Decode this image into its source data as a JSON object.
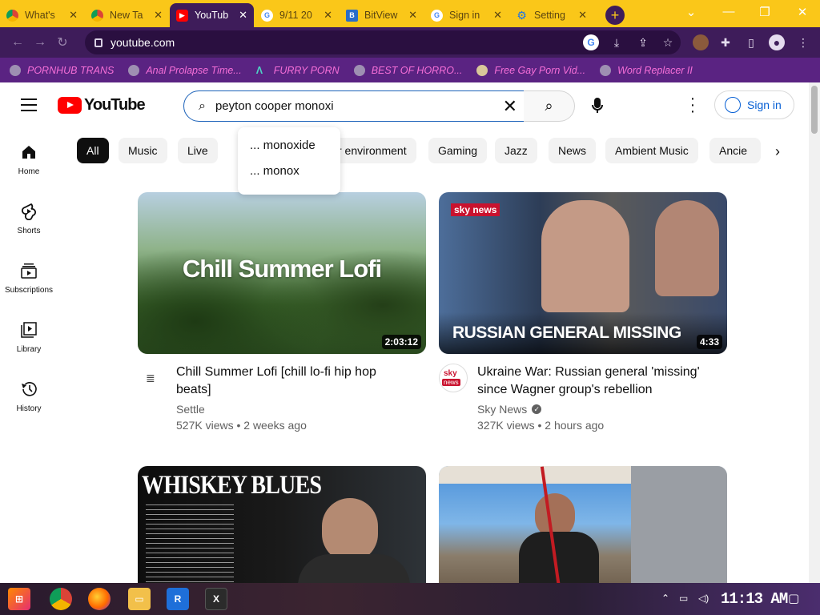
{
  "browser": {
    "tabs": [
      {
        "label": "What's",
        "icon": "chrome-icon",
        "active": false
      },
      {
        "label": "New Ta",
        "icon": "chrome-icon",
        "active": false
      },
      {
        "label": "YouTub",
        "icon": "youtube-icon",
        "active": true
      },
      {
        "label": "9/11 20",
        "icon": "google-icon",
        "active": false
      },
      {
        "label": "BitView",
        "icon": "bitview-icon",
        "active": false
      },
      {
        "label": "Sign in",
        "icon": "google-icon",
        "active": false
      },
      {
        "label": "Setting",
        "icon": "gear-icon",
        "active": false
      }
    ],
    "new_tab_label": "+",
    "url": "youtube.com",
    "bookmarks": [
      {
        "label": "PORNHUB TRANS"
      },
      {
        "label": "Anal Prolapse Time..."
      },
      {
        "label": "FURRY PORN"
      },
      {
        "label": "BEST OF HORRO..."
      },
      {
        "label": "Free Gay Porn Vid..."
      },
      {
        "label": "Word Replacer II"
      }
    ]
  },
  "youtube": {
    "logo_text": "YouTube",
    "search": {
      "query": "peyton cooper monoxi",
      "suggestions": [
        "... monoxide",
        "... monox"
      ]
    },
    "sign_in_label": "Sign in",
    "guide": [
      {
        "label": "Home",
        "icon": "home-icon"
      },
      {
        "label": "Shorts",
        "icon": "shorts-icon"
      },
      {
        "label": "Subscriptions",
        "icon": "subscriptions-icon"
      },
      {
        "label": "Library",
        "icon": "library-icon"
      },
      {
        "label": "History",
        "icon": "history-icon"
      }
    ],
    "chips": [
      "All",
      "Music",
      "Live",
      "r environment",
      "Gaming",
      "Jazz",
      "News",
      "Ambient Music",
      "Ancie"
    ],
    "videos": [
      {
        "title_line1": "Chill Summer Lofi [chill lo-fi hip hop",
        "title_line2": "beats]",
        "thumb_text": "Chill Summer Lofi",
        "duration": "2:03:12",
        "channel": "Settle",
        "meta": "527K views • 2 weeks ago"
      },
      {
        "title_line1": "Ukraine War: Russian general 'missing'",
        "title_line2": "since Wagner group's rebellion",
        "thumb_text": "RUSSIAN GENERAL MISSING",
        "thumb_logo": "sky news",
        "duration": "4:33",
        "channel": "Sky News",
        "meta": "327K views • 2 hours ago"
      },
      {
        "thumb_text": "WHISKEY BLUES"
      },
      {}
    ]
  },
  "taskbar": {
    "clock": "11:13 AM"
  }
}
